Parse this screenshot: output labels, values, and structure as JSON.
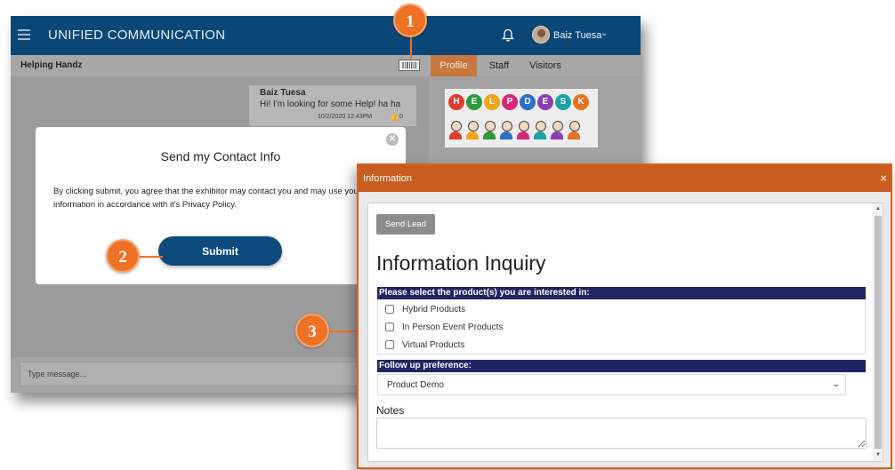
{
  "app": {
    "title": "UNIFIED COMMUNICATION",
    "user_name": "Baiz Tuesa",
    "user_caret": "⌄"
  },
  "subbar": {
    "room_name": "Helping Handz",
    "tabs": [
      {
        "label": "Profile",
        "active": true
      },
      {
        "label": "Staff"
      },
      {
        "label": "Visitors"
      }
    ]
  },
  "chat": {
    "message": {
      "sender": "Baiz Tuesa",
      "text": "Hi! I'm looking for some Help! ha ha",
      "timestamp": "10/2/2020 12:43PM",
      "likes": "0"
    },
    "input_placeholder": "Type message..."
  },
  "helpdesk": {
    "letters": [
      {
        "ch": "H",
        "color": "#e23b2e"
      },
      {
        "ch": "E",
        "color": "#2e9a3c"
      },
      {
        "ch": "L",
        "color": "#f0a41c"
      },
      {
        "ch": "P",
        "color": "#d6267a"
      },
      {
        "ch": "D",
        "color": "#2d6ec8"
      },
      {
        "ch": "E",
        "color": "#8a3fb0"
      },
      {
        "ch": "S",
        "color": "#19a3a3"
      },
      {
        "ch": "K",
        "color": "#e8721c"
      }
    ],
    "people_colors": [
      "#e23b2e",
      "#f0a41c",
      "#2e9a3c",
      "#2d6ec8",
      "#d6267a",
      "#19a3a3",
      "#8a3fb0",
      "#e8721c"
    ]
  },
  "contact_modal": {
    "close_glyph": "✕",
    "title": "Send my Contact Info",
    "body": "By clicking submit, you agree that the exhibitor may contact you and may use your information in accordance with it's Privacy Policy.",
    "submit_label": "Submit"
  },
  "callouts": [
    "1",
    "2",
    "3"
  ],
  "info_modal": {
    "title": "Information",
    "close_glyph": "×",
    "send_lead_label": "Send Lead",
    "heading": "Information Inquiry",
    "products_header": "Please select the product(s) you are interested in:",
    "products": [
      "Hybrid Products",
      "In Person Event Products",
      "Virtual Products"
    ],
    "followup_header": "Follow up preference:",
    "followup_value": "Product Demo",
    "followup_caret": "⌄",
    "notes_label": "Notes"
  },
  "colors": {
    "topbar": "#0b4776",
    "accent_orange": "#ee7125",
    "info_header": "#c85d1f",
    "section_bar": "#1f2663",
    "submit": "#0c4a7d"
  }
}
